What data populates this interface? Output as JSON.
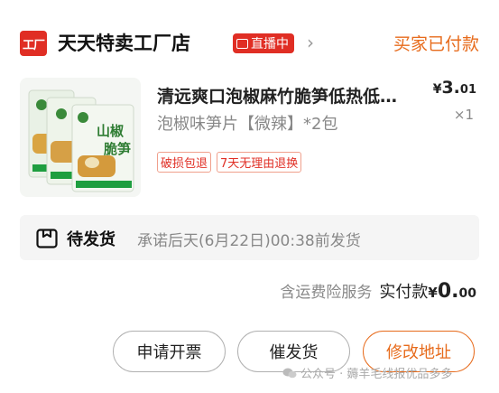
{
  "header": {
    "store_icon_text": "工厂",
    "store_name": "天天特卖工厂店",
    "live_badge": "直播中",
    "order_status": "买家已付款",
    "status_color": "#e76b1c"
  },
  "product": {
    "title": "清远爽口泡椒麻竹脆笋低热低…",
    "spec": "泡椒味笋片【微辣】*2包",
    "price_currency": "¥",
    "price_int": "3.",
    "price_dec": "01",
    "quantity": "×1",
    "package_text": "山椒脆笋",
    "tags": [
      "破损包退",
      "7天无理由退换"
    ]
  },
  "shipping": {
    "label": "待发货",
    "promise": "承诺后天(6月22日)00:38前发货"
  },
  "total": {
    "service_text": "含运费险服务",
    "label": "实付款",
    "currency": "¥",
    "int": "0.",
    "dec": "00"
  },
  "buttons": {
    "invoice": "申请开票",
    "urge": "催发货",
    "change_address": "修改地址"
  },
  "watermark": "公众号 · 薅羊毛线报优品多多",
  "colors": {
    "brand_red": "#e02e24",
    "accent_orange": "#e76b1c"
  }
}
